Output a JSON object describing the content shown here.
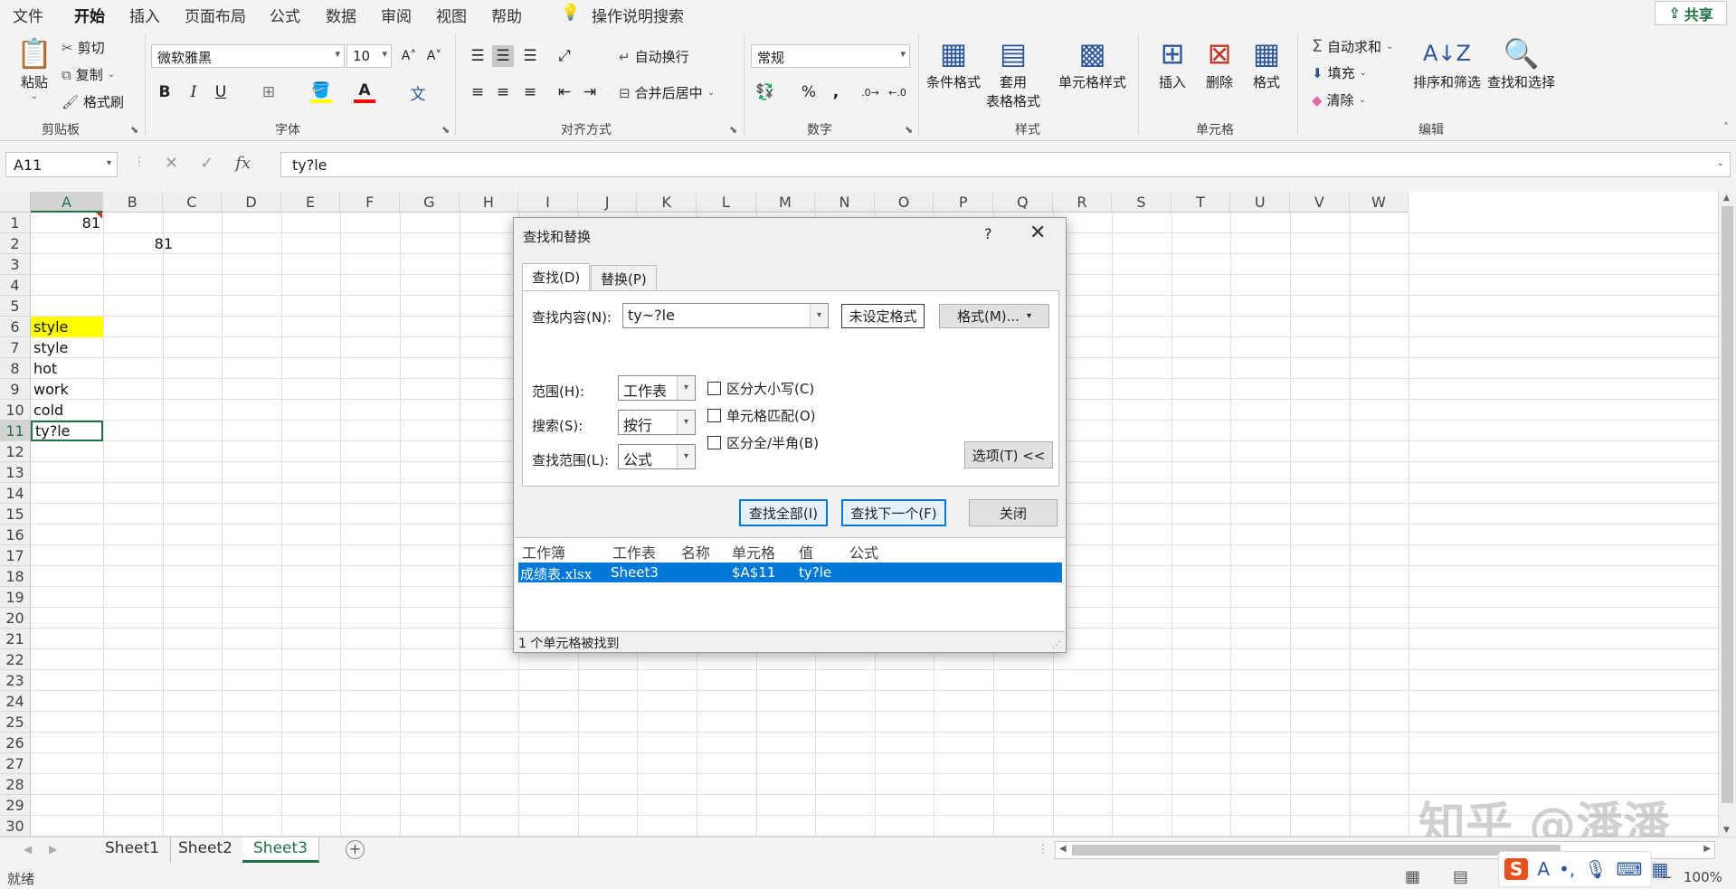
{
  "menu": {
    "tabs": [
      "文件",
      "开始",
      "插入",
      "页面布局",
      "公式",
      "数据",
      "审阅",
      "视图",
      "帮助"
    ],
    "tell_me": "操作说明搜索",
    "share": "共享"
  },
  "ribbon": {
    "clipboard": {
      "paste": "粘贴",
      "cut": "剪切",
      "copy": "复制",
      "format_painter": "格式刷",
      "label": "剪贴板"
    },
    "font": {
      "name": "微软雅黑",
      "size": "10",
      "label": "字体",
      "bold": "B",
      "italic": "I",
      "underline": "U",
      "grow": "A",
      "shrink": "A"
    },
    "alignment": {
      "wrap": "自动换行",
      "merge": "合并后居中",
      "label": "对齐方式"
    },
    "number": {
      "format": "常规",
      "label": "数字",
      "percent": "%",
      "comma": ","
    },
    "styles": {
      "conditional": "条件格式",
      "table_line1": "套用",
      "table_line2": "表格格式",
      "cell_styles": "单元格样式",
      "label": "样式"
    },
    "cells": {
      "insert": "插入",
      "delete": "删除",
      "format": "格式",
      "label": "单元格"
    },
    "editing": {
      "autosum": "自动求和",
      "fill": "填充",
      "clear": "清除",
      "sort": "排序和筛选",
      "find": "查找和选择",
      "label": "编辑"
    }
  },
  "formula_bar": {
    "name_box": "A11",
    "formula": "ty?le",
    "fx": "fx"
  },
  "columns": [
    "A",
    "B",
    "C",
    "D",
    "E",
    "F",
    "G",
    "H",
    "I",
    "J",
    "K",
    "L",
    "M",
    "N",
    "O",
    "P",
    "Q",
    "R",
    "S",
    "T",
    "U",
    "V",
    "W"
  ],
  "rows": [
    "1",
    "2",
    "3",
    "4",
    "5",
    "6",
    "7",
    "8",
    "9",
    "10",
    "11",
    "12",
    "13",
    "14",
    "15",
    "16",
    "17",
    "18",
    "19",
    "20",
    "21",
    "22",
    "23",
    "24",
    "25",
    "26",
    "27",
    "28",
    "29",
    "30"
  ],
  "cells": {
    "a1": "81",
    "b2": "81",
    "a6": "style",
    "a7": "style",
    "a8": "hot",
    "a9": "work",
    "a10": "cold",
    "a11": "ty?le"
  },
  "sheets": [
    "Sheet1",
    "Sheet2",
    "Sheet3"
  ],
  "status": {
    "ready": "就绪",
    "zoom": "100%"
  },
  "dialog": {
    "title": "查找和替换",
    "help": "?",
    "tab_find": "查找(D)",
    "tab_replace": "替换(P)",
    "find_label": "查找内容(N):",
    "find_value": "ty~?le",
    "no_format": "未设定格式",
    "format_btn": "格式(M)...",
    "scope_label": "范围(H):",
    "scope_value": "工作表",
    "search_label": "搜索(S):",
    "search_value": "按行",
    "lookin_label": "查找范围(L):",
    "lookin_value": "公式",
    "match_case": "区分大小写(C)",
    "match_cell": "单元格匹配(O)",
    "match_width": "区分全/半角(B)",
    "options_btn": "选项(T) <<",
    "find_all": "查找全部(I)",
    "find_next": "查找下一个(F)",
    "close": "关闭",
    "result_headers": [
      "工作簿",
      "工作表",
      "名称",
      "单元格",
      "值",
      "公式"
    ],
    "result_row": {
      "workbook": "成绩表.xlsx",
      "sheet": "Sheet3",
      "name": "",
      "cell": "$A$11",
      "value": "ty?le",
      "formula": ""
    },
    "found_status": "1 个单元格被找到"
  },
  "watermark": "知乎 @潘潘"
}
